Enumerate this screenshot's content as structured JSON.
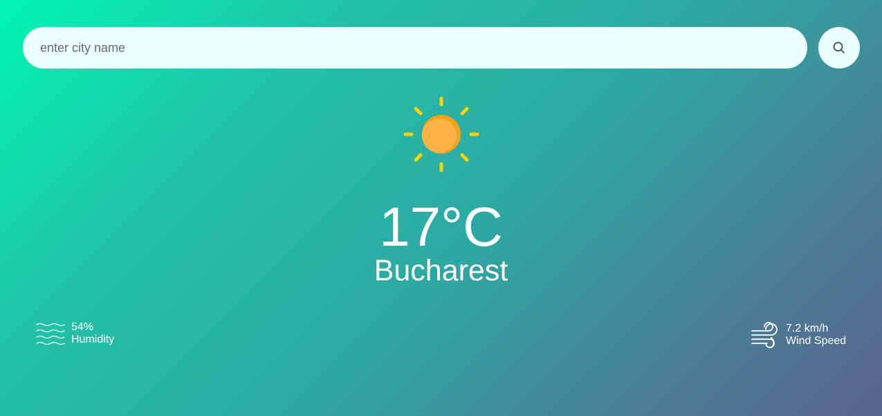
{
  "search": {
    "placeholder": "enter city name",
    "value": "",
    "button_icon": "search-icon"
  },
  "weather": {
    "icon": "sun-icon",
    "temperature": "17°C",
    "city": "Bucharest"
  },
  "details": {
    "humidity": {
      "icon": "humidity-waves-icon",
      "value": "54%",
      "label": "Humidity"
    },
    "wind": {
      "icon": "wind-icon",
      "value": "7.2 km/h",
      "label": "Wind Speed"
    }
  },
  "colors": {
    "gradient_start": "#00f5b4",
    "gradient_end": "#5a6390",
    "search_background": "#eafffc",
    "sun_ray": "#ffd200",
    "sun_body": "#ffb347",
    "text": "#ffffff"
  }
}
